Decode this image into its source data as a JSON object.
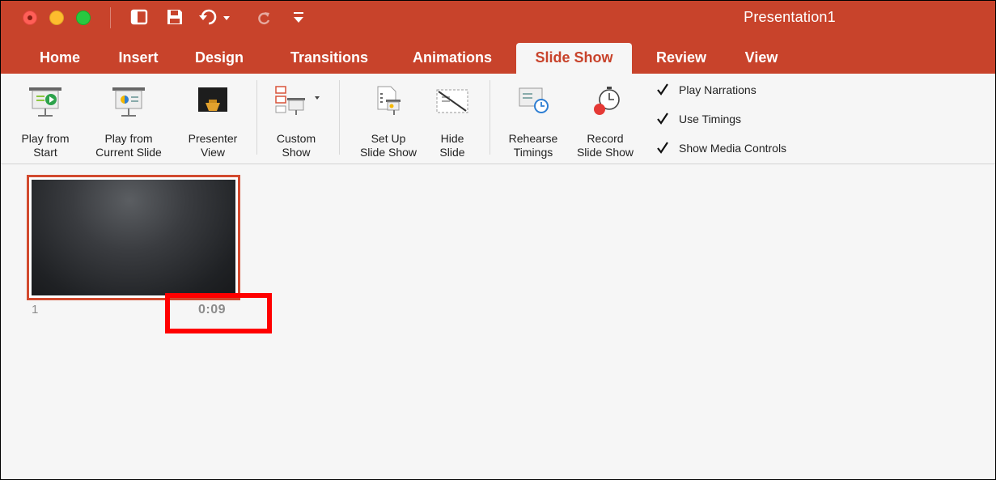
{
  "window": {
    "title": "Presentation1"
  },
  "quick_access": {
    "items": [
      "sidebar-icon",
      "save-icon",
      "undo-icon",
      "redo-icon",
      "customize-icon"
    ]
  },
  "tabs": [
    {
      "label": "Home",
      "active": false
    },
    {
      "label": "Insert",
      "active": false
    },
    {
      "label": "Design",
      "active": false
    },
    {
      "label": "Transitions",
      "active": false
    },
    {
      "label": "Animations",
      "active": false
    },
    {
      "label": "Slide Show",
      "active": true
    },
    {
      "label": "Review",
      "active": false
    },
    {
      "label": "View",
      "active": false
    }
  ],
  "ribbon": {
    "play_from_start": "Play from\nStart",
    "play_from_current": "Play from\nCurrent Slide",
    "presenter_view": "Presenter\nView",
    "custom_show": "Custom\nShow",
    "set_up_slide_show": "Set Up\nSlide Show",
    "hide_slide": "Hide\nSlide",
    "rehearse_timings": "Rehearse\nTimings",
    "record_slide_show": "Record\nSlide Show",
    "checkboxes": [
      {
        "label": "Play Narrations",
        "checked": true
      },
      {
        "label": "Use Timings",
        "checked": true
      },
      {
        "label": "Show Media Controls",
        "checked": true
      }
    ]
  },
  "slides": [
    {
      "number": "1",
      "timing": "0:09"
    }
  ],
  "colors": {
    "accent": "#c8432b",
    "highlight": "#ff0000"
  }
}
